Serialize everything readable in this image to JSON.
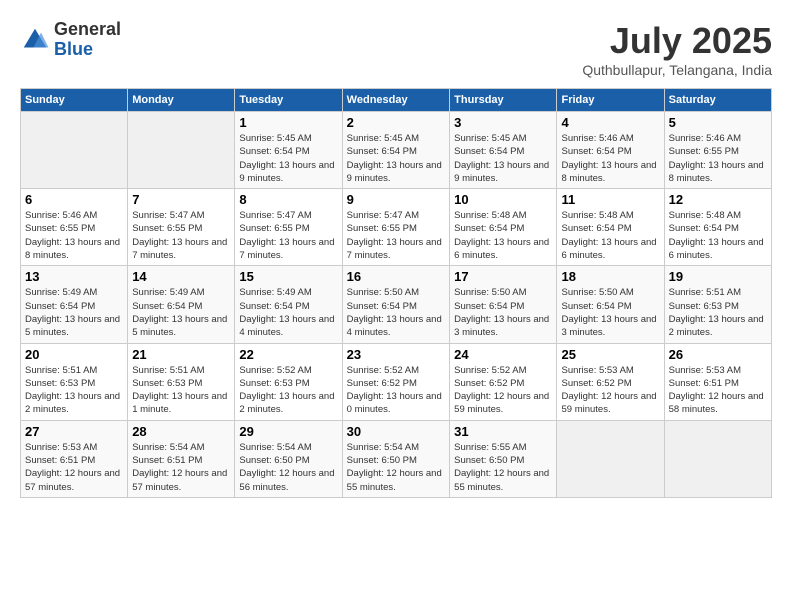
{
  "logo": {
    "general": "General",
    "blue": "Blue"
  },
  "title": "July 2025",
  "location": "Quthbullapur, Telangana, India",
  "days_of_week": [
    "Sunday",
    "Monday",
    "Tuesday",
    "Wednesday",
    "Thursday",
    "Friday",
    "Saturday"
  ],
  "weeks": [
    [
      {
        "day": "",
        "empty": true
      },
      {
        "day": "",
        "empty": true
      },
      {
        "day": "1",
        "info": "Sunrise: 5:45 AM\nSunset: 6:54 PM\nDaylight: 13 hours\nand 9 minutes."
      },
      {
        "day": "2",
        "info": "Sunrise: 5:45 AM\nSunset: 6:54 PM\nDaylight: 13 hours\nand 9 minutes."
      },
      {
        "day": "3",
        "info": "Sunrise: 5:45 AM\nSunset: 6:54 PM\nDaylight: 13 hours\nand 9 minutes."
      },
      {
        "day": "4",
        "info": "Sunrise: 5:46 AM\nSunset: 6:54 PM\nDaylight: 13 hours\nand 8 minutes."
      },
      {
        "day": "5",
        "info": "Sunrise: 5:46 AM\nSunset: 6:55 PM\nDaylight: 13 hours\nand 8 minutes."
      }
    ],
    [
      {
        "day": "6",
        "info": "Sunrise: 5:46 AM\nSunset: 6:55 PM\nDaylight: 13 hours\nand 8 minutes."
      },
      {
        "day": "7",
        "info": "Sunrise: 5:47 AM\nSunset: 6:55 PM\nDaylight: 13 hours\nand 7 minutes."
      },
      {
        "day": "8",
        "info": "Sunrise: 5:47 AM\nSunset: 6:55 PM\nDaylight: 13 hours\nand 7 minutes."
      },
      {
        "day": "9",
        "info": "Sunrise: 5:47 AM\nSunset: 6:55 PM\nDaylight: 13 hours\nand 7 minutes."
      },
      {
        "day": "10",
        "info": "Sunrise: 5:48 AM\nSunset: 6:54 PM\nDaylight: 13 hours\nand 6 minutes."
      },
      {
        "day": "11",
        "info": "Sunrise: 5:48 AM\nSunset: 6:54 PM\nDaylight: 13 hours\nand 6 minutes."
      },
      {
        "day": "12",
        "info": "Sunrise: 5:48 AM\nSunset: 6:54 PM\nDaylight: 13 hours\nand 6 minutes."
      }
    ],
    [
      {
        "day": "13",
        "info": "Sunrise: 5:49 AM\nSunset: 6:54 PM\nDaylight: 13 hours\nand 5 minutes."
      },
      {
        "day": "14",
        "info": "Sunrise: 5:49 AM\nSunset: 6:54 PM\nDaylight: 13 hours\nand 5 minutes."
      },
      {
        "day": "15",
        "info": "Sunrise: 5:49 AM\nSunset: 6:54 PM\nDaylight: 13 hours\nand 4 minutes."
      },
      {
        "day": "16",
        "info": "Sunrise: 5:50 AM\nSunset: 6:54 PM\nDaylight: 13 hours\nand 4 minutes."
      },
      {
        "day": "17",
        "info": "Sunrise: 5:50 AM\nSunset: 6:54 PM\nDaylight: 13 hours\nand 3 minutes."
      },
      {
        "day": "18",
        "info": "Sunrise: 5:50 AM\nSunset: 6:54 PM\nDaylight: 13 hours\nand 3 minutes."
      },
      {
        "day": "19",
        "info": "Sunrise: 5:51 AM\nSunset: 6:53 PM\nDaylight: 13 hours\nand 2 minutes."
      }
    ],
    [
      {
        "day": "20",
        "info": "Sunrise: 5:51 AM\nSunset: 6:53 PM\nDaylight: 13 hours\nand 2 minutes."
      },
      {
        "day": "21",
        "info": "Sunrise: 5:51 AM\nSunset: 6:53 PM\nDaylight: 13 hours\nand 1 minute."
      },
      {
        "day": "22",
        "info": "Sunrise: 5:52 AM\nSunset: 6:53 PM\nDaylight: 13 hours\nand 2 minutes."
      },
      {
        "day": "23",
        "info": "Sunrise: 5:52 AM\nSunset: 6:52 PM\nDaylight: 13 hours\nand 0 minutes."
      },
      {
        "day": "24",
        "info": "Sunrise: 5:52 AM\nSunset: 6:52 PM\nDaylight: 12 hours\nand 59 minutes."
      },
      {
        "day": "25",
        "info": "Sunrise: 5:53 AM\nSunset: 6:52 PM\nDaylight: 12 hours\nand 59 minutes."
      },
      {
        "day": "26",
        "info": "Sunrise: 5:53 AM\nSunset: 6:51 PM\nDaylight: 12 hours\nand 58 minutes."
      }
    ],
    [
      {
        "day": "27",
        "info": "Sunrise: 5:53 AM\nSunset: 6:51 PM\nDaylight: 12 hours\nand 57 minutes."
      },
      {
        "day": "28",
        "info": "Sunrise: 5:54 AM\nSunset: 6:51 PM\nDaylight: 12 hours\nand 57 minutes."
      },
      {
        "day": "29",
        "info": "Sunrise: 5:54 AM\nSunset: 6:50 PM\nDaylight: 12 hours\nand 56 minutes."
      },
      {
        "day": "30",
        "info": "Sunrise: 5:54 AM\nSunset: 6:50 PM\nDaylight: 12 hours\nand 55 minutes."
      },
      {
        "day": "31",
        "info": "Sunrise: 5:55 AM\nSunset: 6:50 PM\nDaylight: 12 hours\nand 55 minutes."
      },
      {
        "day": "",
        "empty": true
      },
      {
        "day": "",
        "empty": true
      }
    ]
  ]
}
